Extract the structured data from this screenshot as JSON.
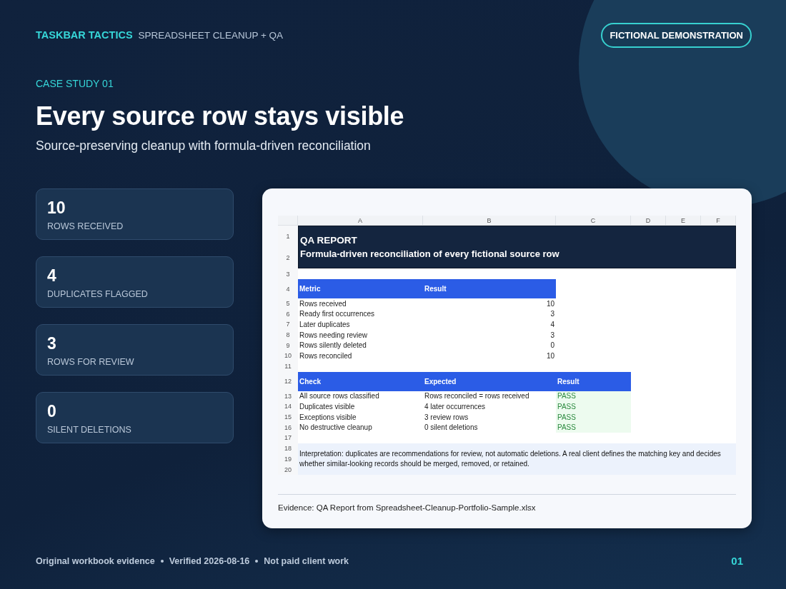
{
  "header": {
    "brand": "TASKBAR TACTICS",
    "section": "SPREADSHEET CLEANUP + QA",
    "badge": "FICTIONAL DEMONSTRATION"
  },
  "eyebrow": "CASE STUDY 01",
  "title": "Every source row stays visible",
  "subtitle": "Source-preserving cleanup with formula-driven reconciliation",
  "stats": [
    {
      "value": "10",
      "label": "ROWS RECEIVED"
    },
    {
      "value": "4",
      "label": "DUPLICATES FLAGGED"
    },
    {
      "value": "3",
      "label": "ROWS FOR REVIEW"
    },
    {
      "value": "0",
      "label": "SILENT DELETIONS"
    }
  ],
  "sheet": {
    "columns": [
      "A",
      "B",
      "C",
      "D",
      "E",
      "F"
    ],
    "rows": [
      {
        "kind": "title",
        "numbers": [
          "1",
          "2"
        ],
        "lines": [
          "QA REPORT",
          "Formula-driven reconciliation of every fictional source row"
        ]
      },
      {
        "kind": "blank",
        "number": "3"
      },
      {
        "kind": "header",
        "number": "4",
        "cells": [
          "Metric",
          "Result"
        ]
      },
      {
        "kind": "metric",
        "number": "5",
        "cells": [
          "Rows received",
          "10"
        ]
      },
      {
        "kind": "metric",
        "number": "6",
        "cells": [
          "Ready first occurrences",
          "3"
        ]
      },
      {
        "kind": "metric",
        "number": "7",
        "cells": [
          "Later duplicates",
          "4"
        ]
      },
      {
        "kind": "metric",
        "number": "8",
        "cells": [
          "Rows needing review",
          "3"
        ]
      },
      {
        "kind": "metric",
        "number": "9",
        "cells": [
          "Rows silently deleted",
          "0"
        ]
      },
      {
        "kind": "metric",
        "number": "10",
        "cells": [
          "Rows reconciled",
          "10"
        ]
      },
      {
        "kind": "blank",
        "number": "11"
      },
      {
        "kind": "header",
        "number": "12",
        "cells": [
          "Check",
          "Expected",
          "Result"
        ]
      },
      {
        "kind": "check",
        "number": "13",
        "cells": [
          "All source rows classified",
          "Rows reconciled = rows received",
          "PASS"
        ]
      },
      {
        "kind": "check",
        "number": "14",
        "cells": [
          "Duplicates visible",
          "4 later occurrences",
          "PASS"
        ]
      },
      {
        "kind": "check",
        "number": "15",
        "cells": [
          "Exceptions visible",
          "3 review rows",
          "PASS"
        ]
      },
      {
        "kind": "check",
        "number": "16",
        "cells": [
          "No destructive cleanup",
          "0 silent deletions",
          "PASS"
        ]
      },
      {
        "kind": "blank",
        "number": "17"
      },
      {
        "kind": "note",
        "numbers": [
          "18",
          "19",
          "20"
        ],
        "text": "Interpretation: duplicates are recommendations for review, not automatic deletions. A real client defines the matching key and decides whether similar-looking records should be merged, removed, or retained."
      }
    ]
  },
  "caption": "Evidence: QA Report from Spreadsheet-Cleanup-Portfolio-Sample.xlsx",
  "footer": {
    "notes": [
      "Original workbook evidence",
      "Verified 2026-08-16",
      "Not paid client work"
    ],
    "page": "01"
  }
}
